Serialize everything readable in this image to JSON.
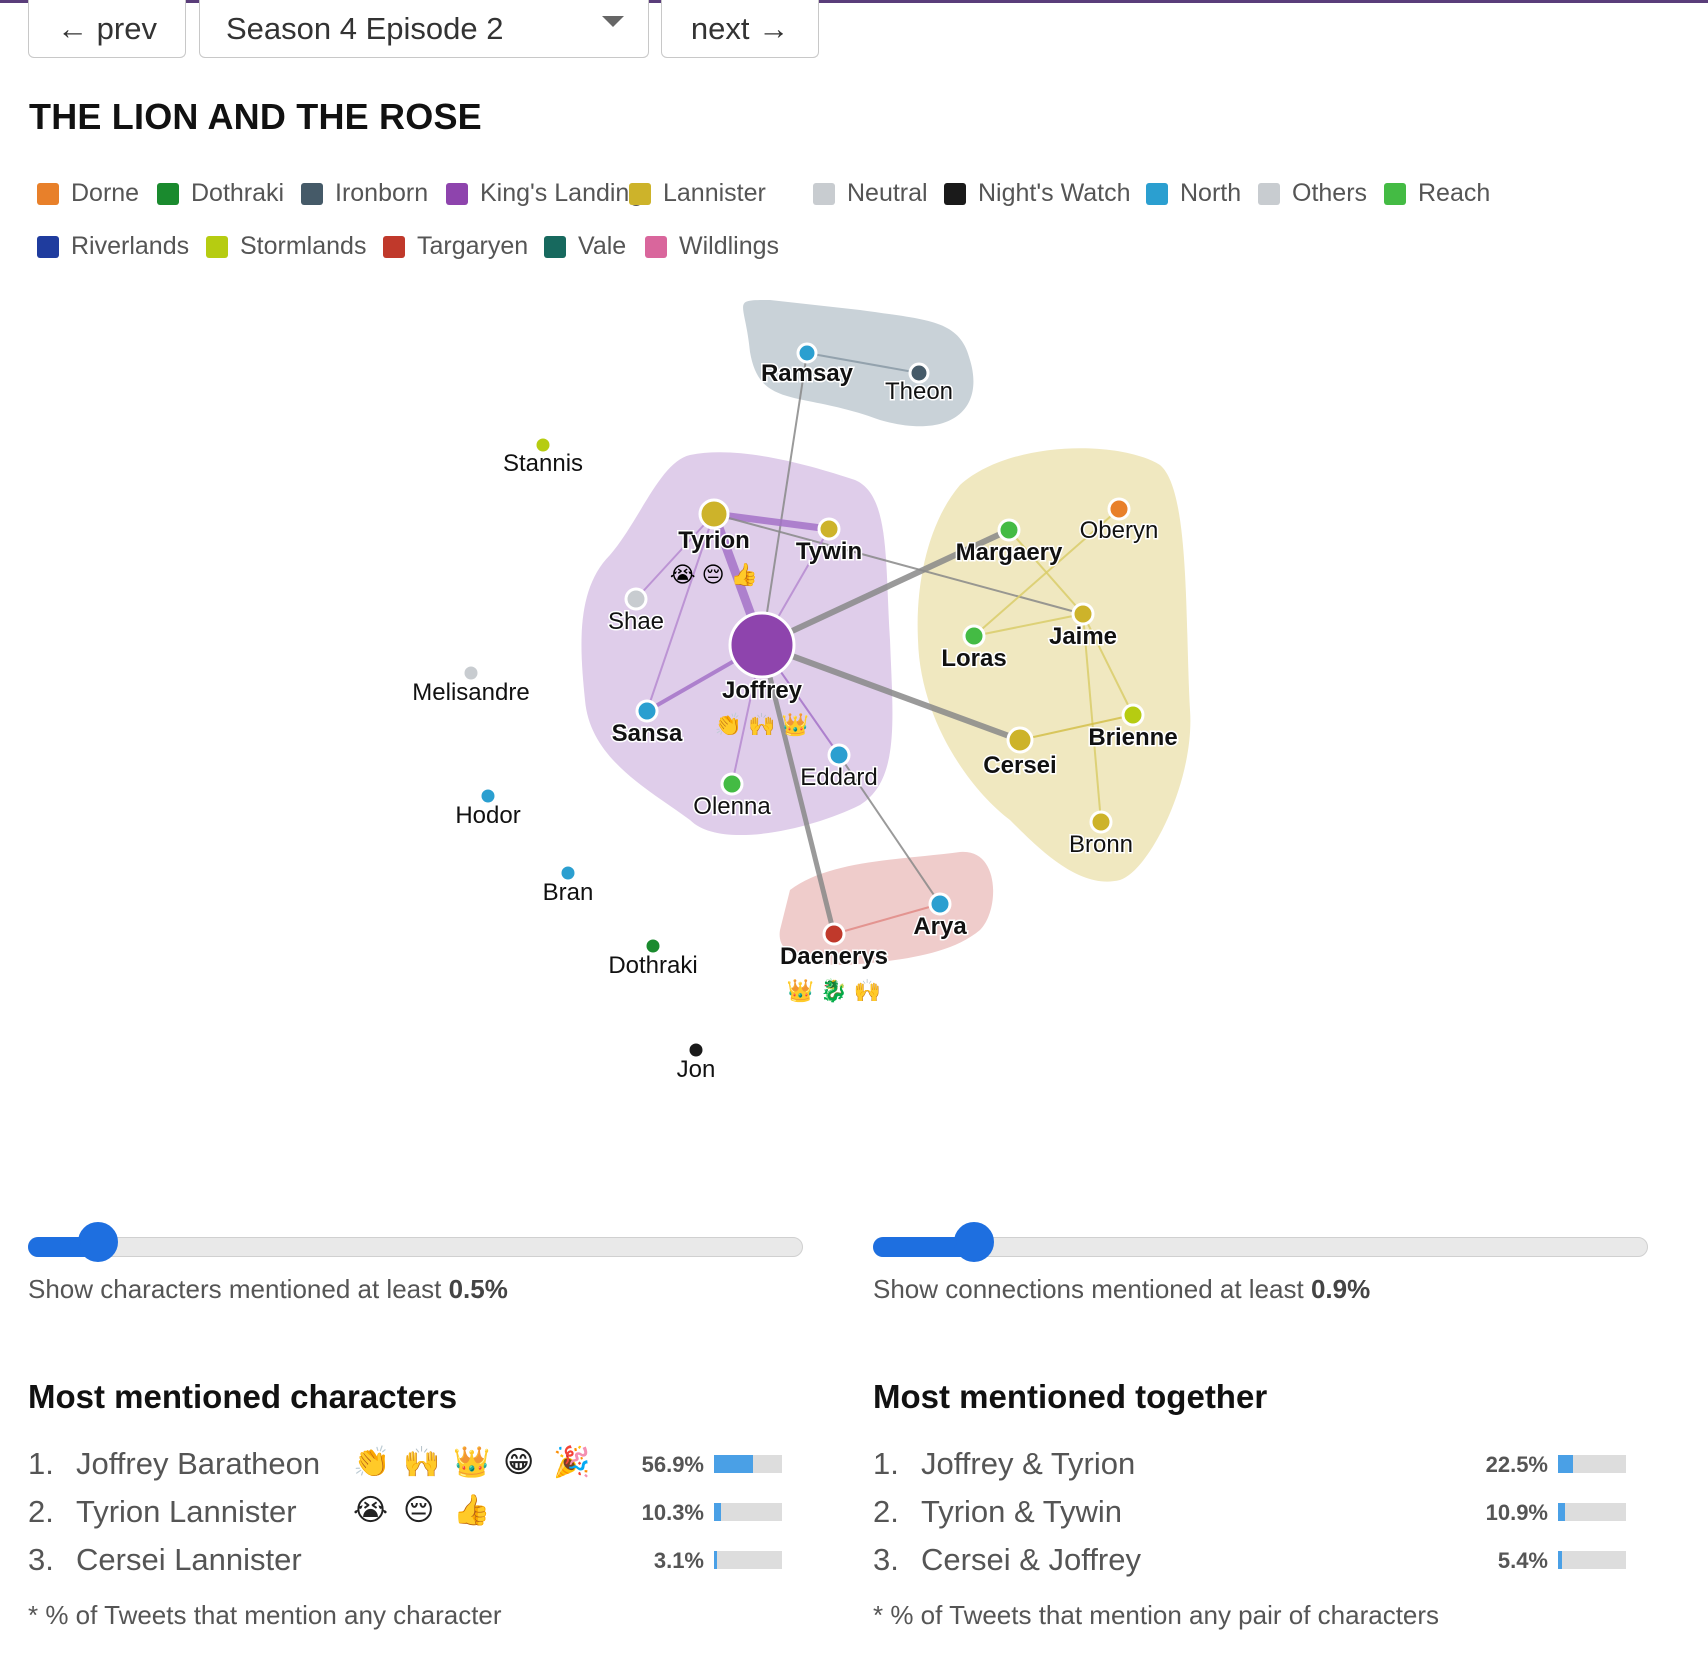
{
  "nav": {
    "prev_label": "← prev",
    "episode_selected": "Season 4 Episode 2",
    "next_label": "next →"
  },
  "episode_title": "THE LION AND THE ROSE",
  "legend": [
    {
      "label": "Dorne",
      "color": "#e8802a"
    },
    {
      "label": "Dothraki",
      "color": "#1a8a2e"
    },
    {
      "label": "Ironborn",
      "color": "#455a68"
    },
    {
      "label": "King's Landing",
      "color": "#8e44ad"
    },
    {
      "label": "Lannister",
      "color": "#cdb32a"
    },
    {
      "label": "Neutral",
      "color": "#c8ccd0"
    },
    {
      "label": "Night's Watch",
      "color": "#1a1a1a"
    },
    {
      "label": "North",
      "color": "#2b9fd0"
    },
    {
      "label": "Others",
      "color": "#c8ccd0"
    },
    {
      "label": "Reach",
      "color": "#44bb44"
    },
    {
      "label": "Riverlands",
      "color": "#1f3c9e"
    },
    {
      "label": "Stormlands",
      "color": "#b6cc11"
    },
    {
      "label": "Targaryen",
      "color": "#c0392b"
    },
    {
      "label": "Vale",
      "color": "#17695e"
    },
    {
      "label": "Wildlings",
      "color": "#d9669c"
    }
  ],
  "graph": {
    "characters": [
      {
        "name": "Ramsay",
        "faction": "North",
        "bold": true
      },
      {
        "name": "Theon",
        "faction": "Ironborn",
        "bold": false
      },
      {
        "name": "Stannis",
        "faction": "Stormlands",
        "bold": false
      },
      {
        "name": "Tyrion",
        "faction": "Lannister",
        "bold": true,
        "emojis": "😭 😔 👍"
      },
      {
        "name": "Tywin",
        "faction": "Lannister",
        "bold": true
      },
      {
        "name": "Shae",
        "faction": "Neutral",
        "bold": false
      },
      {
        "name": "Joffrey",
        "faction": "King's Landing",
        "bold": true,
        "emojis": "👏 🙌 👑"
      },
      {
        "name": "Sansa",
        "faction": "North",
        "bold": true
      },
      {
        "name": "Olenna",
        "faction": "Reach",
        "bold": false
      },
      {
        "name": "Eddard",
        "faction": "North",
        "bold": false
      },
      {
        "name": "Melisandre",
        "faction": "Neutral",
        "bold": false
      },
      {
        "name": "Hodor",
        "faction": "North",
        "bold": false
      },
      {
        "name": "Bran",
        "faction": "North",
        "bold": false
      },
      {
        "name": "Dothraki",
        "faction": "Dothraki",
        "bold": false
      },
      {
        "name": "Jon",
        "faction": "Night's Watch",
        "bold": false
      },
      {
        "name": "Margaery",
        "faction": "Reach",
        "bold": true
      },
      {
        "name": "Oberyn",
        "faction": "Dorne",
        "bold": false
      },
      {
        "name": "Jaime",
        "faction": "Lannister",
        "bold": true
      },
      {
        "name": "Loras",
        "faction": "Reach",
        "bold": true
      },
      {
        "name": "Brienne",
        "faction": "Stormlands",
        "bold": true
      },
      {
        "name": "Cersei",
        "faction": "Lannister",
        "bold": true
      },
      {
        "name": "Bronn",
        "faction": "Lannister",
        "bold": false
      },
      {
        "name": "Arya",
        "faction": "North",
        "bold": true
      },
      {
        "name": "Daenerys",
        "faction": "Targaryen",
        "bold": true,
        "emojis": "👑 🐉 🙌"
      }
    ],
    "connections": [
      [
        "Ramsay",
        "Theon"
      ],
      [
        "Ramsay",
        "Joffrey"
      ],
      [
        "Tyrion",
        "Tywin"
      ],
      [
        "Tyrion",
        "Joffrey"
      ],
      [
        "Tyrion",
        "Shae"
      ],
      [
        "Tyrion",
        "Sansa"
      ],
      [
        "Tyrion",
        "Jaime"
      ],
      [
        "Tywin",
        "Joffrey"
      ],
      [
        "Joffrey",
        "Sansa"
      ],
      [
        "Joffrey",
        "Olenna"
      ],
      [
        "Joffrey",
        "Eddard"
      ],
      [
        "Joffrey",
        "Margaery"
      ],
      [
        "Joffrey",
        "Cersei"
      ],
      [
        "Joffrey",
        "Daenerys"
      ],
      [
        "Eddard",
        "Arya"
      ],
      [
        "Arya",
        "Daenerys"
      ],
      [
        "Margaery",
        "Jaime"
      ],
      [
        "Oberyn",
        "Loras"
      ],
      [
        "Loras",
        "Jaime"
      ],
      [
        "Jaime",
        "Brienne"
      ],
      [
        "Jaime",
        "Bronn"
      ],
      [
        "Brienne",
        "Cersei"
      ]
    ]
  },
  "sliders": {
    "characters": {
      "label": "Show characters mentioned at least ",
      "value": "0.5%",
      "level": 0.07
    },
    "connections": {
      "label": "Show connections mentioned at least ",
      "value": "0.9%",
      "level": 0.11
    }
  },
  "most_mentioned": {
    "title": "Most mentioned characters",
    "items": [
      {
        "rank": "1.",
        "name": "Joffrey Baratheon",
        "emojis": [
          "👏",
          "🙌",
          "👑",
          "😁",
          "🎉"
        ],
        "pct": "56.9%",
        "level": 0.569
      },
      {
        "rank": "2.",
        "name": "Tyrion Lannister",
        "emojis": [
          "😭",
          "😔",
          "👍"
        ],
        "pct": "10.3%",
        "level": 0.103
      },
      {
        "rank": "3.",
        "name": "Cersei Lannister",
        "emojis": [],
        "pct": "3.1%",
        "level": 0.031
      }
    ],
    "note": "* % of Tweets that mention any character"
  },
  "most_together": {
    "title": "Most mentioned together",
    "items": [
      {
        "rank": "1.",
        "name": "Joffrey & Tyrion",
        "pct": "22.5%",
        "level": 0.225
      },
      {
        "rank": "2.",
        "name": "Tyrion & Tywin",
        "pct": "10.9%",
        "level": 0.109
      },
      {
        "rank": "3.",
        "name": "Cersei & Joffrey",
        "pct": "5.4%",
        "level": 0.054
      }
    ],
    "note": "* % of Tweets that mention any pair of characters"
  }
}
